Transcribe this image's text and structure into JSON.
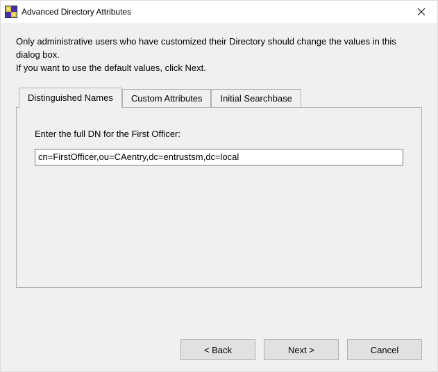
{
  "window": {
    "title": "Advanced Directory Attributes"
  },
  "intro": {
    "line1": "Only administrative users who have customized their Directory should change the values in this dialog box.",
    "line2": "If you want to use the default values, click Next."
  },
  "tabs": {
    "t0": "Distinguished Names",
    "t1": "Custom Attributes",
    "t2": "Initial Searchbase",
    "active_index": 0
  },
  "panel": {
    "label": "Enter the full DN for the First Officer:",
    "value": "cn=FirstOfficer,ou=CAentry,dc=entrustsm,dc=local"
  },
  "buttons": {
    "back": "< Back",
    "next": "Next >",
    "cancel": "Cancel"
  }
}
